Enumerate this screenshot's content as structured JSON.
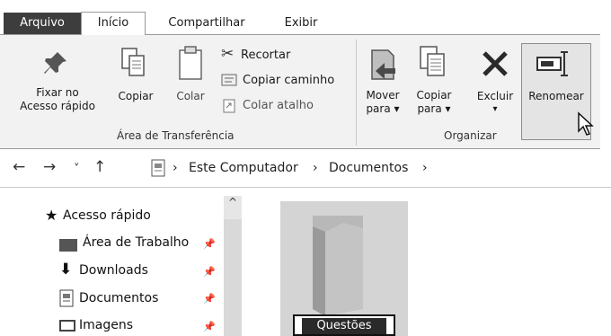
{
  "tabs": {
    "file": "Arquivo",
    "home": "Início",
    "share": "Compartilhar",
    "view": "Exibir"
  },
  "ribbon": {
    "pin_label_1": "Fixar no",
    "pin_label_2": "Acesso rápido",
    "copy": "Copiar",
    "paste": "Colar",
    "cut": "Recortar",
    "copy_path": "Copiar caminho",
    "paste_shortcut": "Colar atalho",
    "group_clipboard": "Área de Transferência",
    "move_1": "Mover",
    "move_2": "para ▾",
    "copyto_1": "Copiar",
    "copyto_2": "para ▾",
    "delete": "Excluir",
    "delete_arrow": "▾",
    "rename": "Renomear",
    "group_organize": "Organizar"
  },
  "address": {
    "back": "←",
    "forward": "→",
    "recent": "˅",
    "up": "↑",
    "sep1": "›",
    "crumb1": "Este Computador",
    "sep2": "›",
    "crumb2": "Documentos",
    "sep3": "›"
  },
  "nav": {
    "quick_access": "Acesso rápido",
    "desktop": "Área de Trabalho",
    "downloads": "Downloads",
    "documents": "Documentos",
    "images": "Imagens",
    "pin": "📌"
  },
  "content": {
    "folder_name": "Questões"
  }
}
